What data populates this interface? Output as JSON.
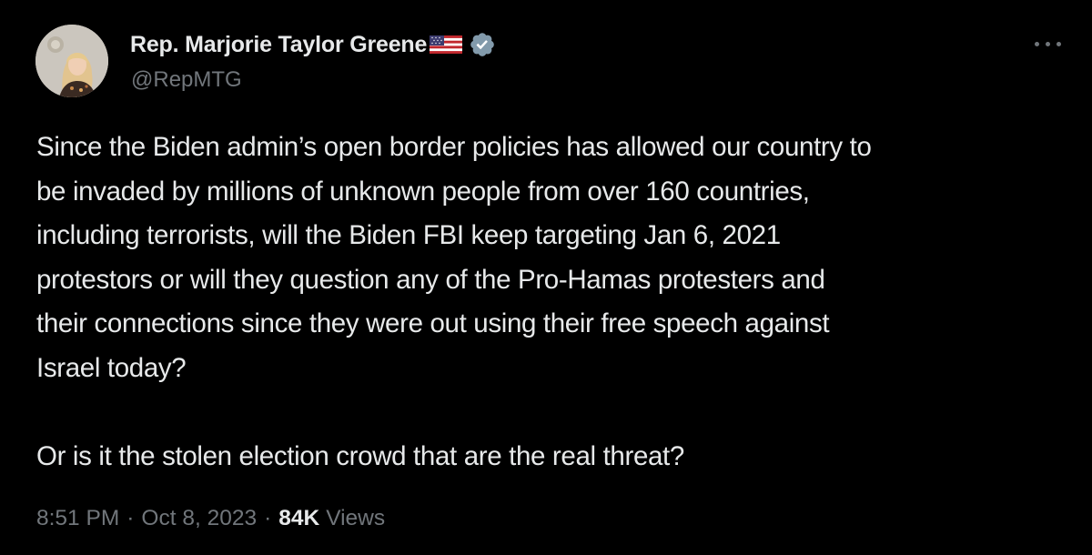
{
  "author": {
    "display_name": "Rep. Marjorie Taylor Greene",
    "handle": "@RepMTG",
    "flag_icon": "us-flag-icon",
    "verified_icon": "verified-badge-icon",
    "verified_color": "#829aab"
  },
  "menu": {
    "more_icon": "more-options-icon"
  },
  "tweet": {
    "lines": [
      "Since the Biden admin’s open border policies has allowed our country to",
      "be invaded by millions of unknown people from over 160 countries,",
      "including terrorists, will the Biden FBI keep targeting Jan 6, 2021",
      "protestors or will they question any of the Pro-Hamas protesters and",
      "their connections since they were out using their free speech against",
      "Israel today?",
      "",
      "Or is it the stolen election crowd that are the real threat?"
    ]
  },
  "meta": {
    "time": "8:51 PM",
    "separator": "·",
    "date": "Oct 8, 2023",
    "views_count": "84K",
    "views_label": "Views"
  },
  "colors": {
    "background": "#000000",
    "primary_text": "#e7e9ea",
    "secondary_text": "#71767b"
  }
}
